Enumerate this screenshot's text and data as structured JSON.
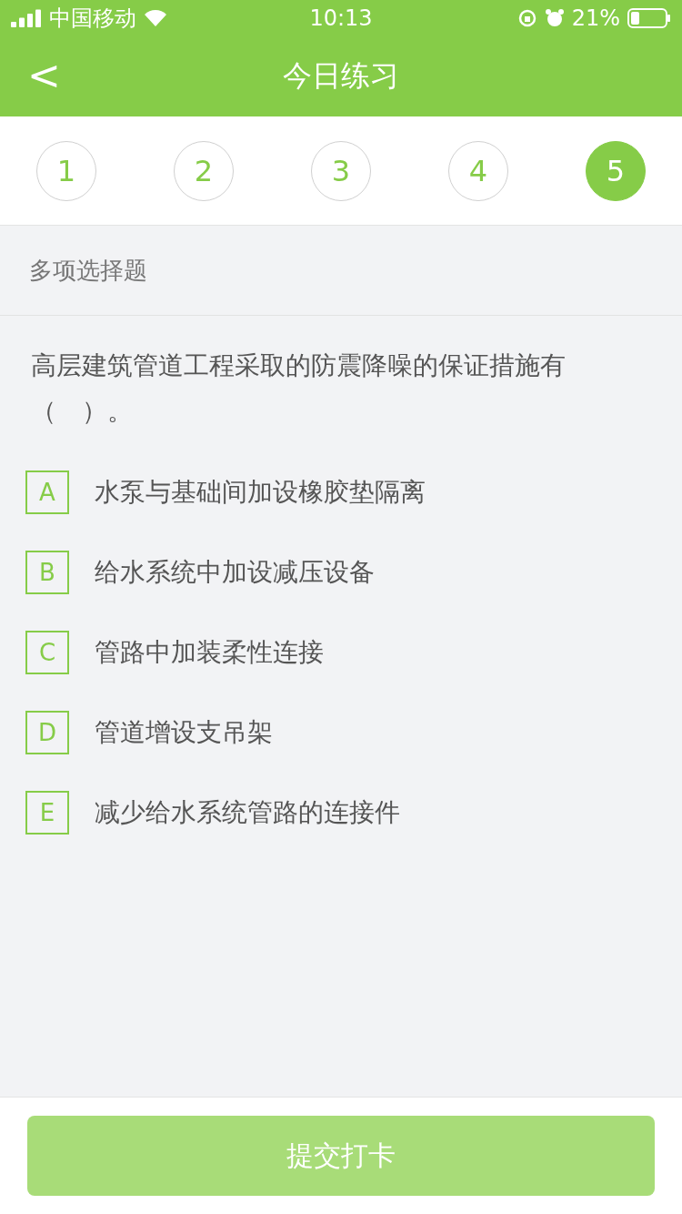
{
  "status_bar": {
    "carrier": "中国移动",
    "time": "10:13",
    "battery": "21%"
  },
  "nav": {
    "back": "<",
    "title": "今日练习"
  },
  "steps": [
    {
      "label": "1",
      "selected": false
    },
    {
      "label": "2",
      "selected": false
    },
    {
      "label": "3",
      "selected": false
    },
    {
      "label": "4",
      "selected": false
    },
    {
      "label": "5",
      "selected": true
    }
  ],
  "question_type": "多项选择题",
  "question": "高层建筑管道工程采取的防震降噪的保证措施有（　）。",
  "options": [
    {
      "key": "A",
      "text": "水泵与基础间加设橡胶垫隔离",
      "selected": false
    },
    {
      "key": "B",
      "text": "给水系统中加设减压设备",
      "selected": false
    },
    {
      "key": "C",
      "text": "管路中加装柔性连接",
      "selected": false
    },
    {
      "key": "D",
      "text": "管道增设支吊架",
      "selected": false
    },
    {
      "key": "E",
      "text": "减少给水系统管路的连接件",
      "selected": false
    }
  ],
  "submit": {
    "label": "提交打卡",
    "disabled": true
  }
}
